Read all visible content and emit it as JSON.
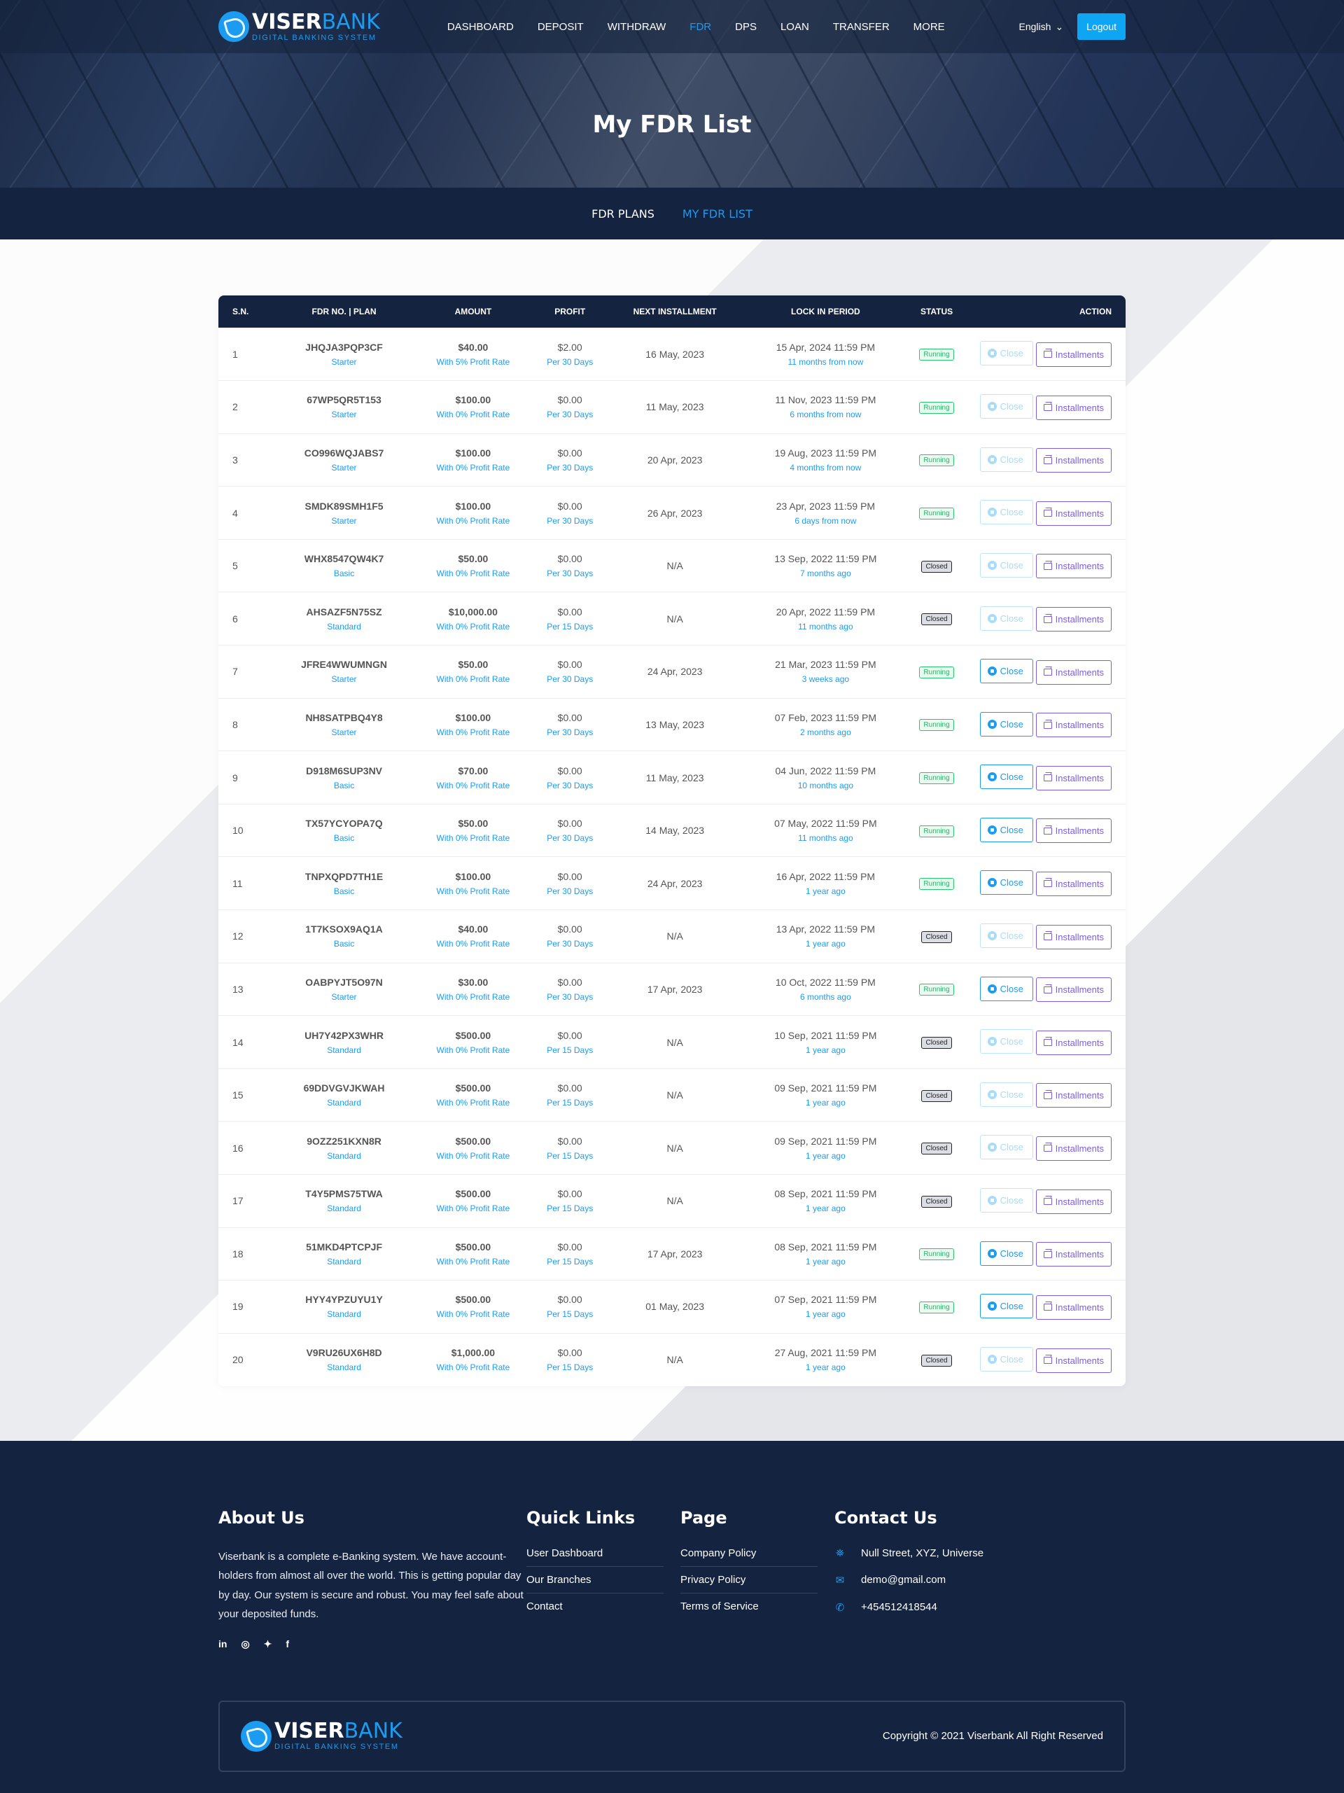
{
  "brand": {
    "name_main": "VISER",
    "name_accent": "BANK",
    "tagline": "DIGITAL BANKING SYSTEM"
  },
  "nav": {
    "items": [
      {
        "label": "DASHBOARD",
        "active": false
      },
      {
        "label": "DEPOSIT",
        "active": false
      },
      {
        "label": "WITHDRAW",
        "active": false
      },
      {
        "label": "FDR",
        "active": true
      },
      {
        "label": "DPS",
        "active": false
      },
      {
        "label": "LOAN",
        "active": false
      },
      {
        "label": "TRANSFER",
        "active": false
      },
      {
        "label": "MORE",
        "active": false
      }
    ],
    "language": "English",
    "logout_label": "Logout"
  },
  "hero": {
    "title": "My FDR List"
  },
  "subnav": [
    {
      "label": "FDR PLANS",
      "active": false
    },
    {
      "label": "MY FDR LIST",
      "active": true
    }
  ],
  "table": {
    "columns": [
      "S.N.",
      "FDR NO. | PLAN",
      "AMOUNT",
      "PROFIT",
      "NEXT INSTALLMENT",
      "LOCK IN PERIOD",
      "STATUS",
      "ACTION"
    ],
    "close_label": "Close",
    "installments_label": "Installments",
    "rows": [
      {
        "sn": "1",
        "fdr_no": "JHQJA3PQP3CF",
        "plan": "Starter",
        "amount": "$40.00",
        "rate": "With 5% Profit Rate",
        "profit": "$2.00",
        "per": "Per 30 Days",
        "next": "16 May, 2023",
        "lock": "15 Apr, 2024 11:59 PM",
        "lock_rel": "11 months from now",
        "status": "Running",
        "close_enabled": false
      },
      {
        "sn": "2",
        "fdr_no": "67WP5QR5T153",
        "plan": "Starter",
        "amount": "$100.00",
        "rate": "With 0% Profit Rate",
        "profit": "$0.00",
        "per": "Per 30 Days",
        "next": "11 May, 2023",
        "lock": "11 Nov, 2023 11:59 PM",
        "lock_rel": "6 months from now",
        "status": "Running",
        "close_enabled": false
      },
      {
        "sn": "3",
        "fdr_no": "CO996WQJABS7",
        "plan": "Starter",
        "amount": "$100.00",
        "rate": "With 0% Profit Rate",
        "profit": "$0.00",
        "per": "Per 30 Days",
        "next": "20 Apr, 2023",
        "lock": "19 Aug, 2023 11:59 PM",
        "lock_rel": "4 months from now",
        "status": "Running",
        "close_enabled": false
      },
      {
        "sn": "4",
        "fdr_no": "SMDK89SMH1F5",
        "plan": "Starter",
        "amount": "$100.00",
        "rate": "With 0% Profit Rate",
        "profit": "$0.00",
        "per": "Per 30 Days",
        "next": "26 Apr, 2023",
        "lock": "23 Apr, 2023 11:59 PM",
        "lock_rel": "6 days from now",
        "status": "Running",
        "close_enabled": false
      },
      {
        "sn": "5",
        "fdr_no": "WHX8547QW4K7",
        "plan": "Basic",
        "amount": "$50.00",
        "rate": "With 0% Profit Rate",
        "profit": "$0.00",
        "per": "Per 30 Days",
        "next": "N/A",
        "lock": "13 Sep, 2022 11:59 PM",
        "lock_rel": "7 months ago",
        "status": "Closed",
        "close_enabled": false
      },
      {
        "sn": "6",
        "fdr_no": "AHSAZF5N75SZ",
        "plan": "Standard",
        "amount": "$10,000.00",
        "rate": "With 0% Profit Rate",
        "profit": "$0.00",
        "per": "Per 15 Days",
        "next": "N/A",
        "lock": "20 Apr, 2022 11:59 PM",
        "lock_rel": "11 months ago",
        "status": "Closed",
        "close_enabled": false
      },
      {
        "sn": "7",
        "fdr_no": "JFRE4WWUMNGN",
        "plan": "Starter",
        "amount": "$50.00",
        "rate": "With 0% Profit Rate",
        "profit": "$0.00",
        "per": "Per 30 Days",
        "next": "24 Apr, 2023",
        "lock": "21 Mar, 2023 11:59 PM",
        "lock_rel": "3 weeks ago",
        "status": "Running",
        "close_enabled": true
      },
      {
        "sn": "8",
        "fdr_no": "NH8SATPBQ4Y8",
        "plan": "Starter",
        "amount": "$100.00",
        "rate": "With 0% Profit Rate",
        "profit": "$0.00",
        "per": "Per 30 Days",
        "next": "13 May, 2023",
        "lock": "07 Feb, 2023 11:59 PM",
        "lock_rel": "2 months ago",
        "status": "Running",
        "close_enabled": true
      },
      {
        "sn": "9",
        "fdr_no": "D918M6SUP3NV",
        "plan": "Basic",
        "amount": "$70.00",
        "rate": "With 0% Profit Rate",
        "profit": "$0.00",
        "per": "Per 30 Days",
        "next": "11 May, 2023",
        "lock": "04 Jun, 2022 11:59 PM",
        "lock_rel": "10 months ago",
        "status": "Running",
        "close_enabled": true
      },
      {
        "sn": "10",
        "fdr_no": "TX57YCYOPA7Q",
        "plan": "Basic",
        "amount": "$50.00",
        "rate": "With 0% Profit Rate",
        "profit": "$0.00",
        "per": "Per 30 Days",
        "next": "14 May, 2023",
        "lock": "07 May, 2022 11:59 PM",
        "lock_rel": "11 months ago",
        "status": "Running",
        "close_enabled": true
      },
      {
        "sn": "11",
        "fdr_no": "TNPXQPD7TH1E",
        "plan": "Basic",
        "amount": "$100.00",
        "rate": "With 0% Profit Rate",
        "profit": "$0.00",
        "per": "Per 30 Days",
        "next": "24 Apr, 2023",
        "lock": "16 Apr, 2022 11:59 PM",
        "lock_rel": "1 year ago",
        "status": "Running",
        "close_enabled": true
      },
      {
        "sn": "12",
        "fdr_no": "1T7KSOX9AQ1A",
        "plan": "Basic",
        "amount": "$40.00",
        "rate": "With 0% Profit Rate",
        "profit": "$0.00",
        "per": "Per 30 Days",
        "next": "N/A",
        "lock": "13 Apr, 2022 11:59 PM",
        "lock_rel": "1 year ago",
        "status": "Closed",
        "close_enabled": false
      },
      {
        "sn": "13",
        "fdr_no": "OABPYJT5O97N",
        "plan": "Starter",
        "amount": "$30.00",
        "rate": "With 0% Profit Rate",
        "profit": "$0.00",
        "per": "Per 30 Days",
        "next": "17 Apr, 2023",
        "lock": "10 Oct, 2022 11:59 PM",
        "lock_rel": "6 months ago",
        "status": "Running",
        "close_enabled": true
      },
      {
        "sn": "14",
        "fdr_no": "UH7Y42PX3WHR",
        "plan": "Standard",
        "amount": "$500.00",
        "rate": "With 0% Profit Rate",
        "profit": "$0.00",
        "per": "Per 15 Days",
        "next": "N/A",
        "lock": "10 Sep, 2021 11:59 PM",
        "lock_rel": "1 year ago",
        "status": "Closed",
        "close_enabled": false
      },
      {
        "sn": "15",
        "fdr_no": "69DDVGVJKWAH",
        "plan": "Standard",
        "amount": "$500.00",
        "rate": "With 0% Profit Rate",
        "profit": "$0.00",
        "per": "Per 15 Days",
        "next": "N/A",
        "lock": "09 Sep, 2021 11:59 PM",
        "lock_rel": "1 year ago",
        "status": "Closed",
        "close_enabled": false
      },
      {
        "sn": "16",
        "fdr_no": "9OZZ251KXN8R",
        "plan": "Standard",
        "amount": "$500.00",
        "rate": "With 0% Profit Rate",
        "profit": "$0.00",
        "per": "Per 15 Days",
        "next": "N/A",
        "lock": "09 Sep, 2021 11:59 PM",
        "lock_rel": "1 year ago",
        "status": "Closed",
        "close_enabled": false
      },
      {
        "sn": "17",
        "fdr_no": "T4Y5PMS75TWA",
        "plan": "Standard",
        "amount": "$500.00",
        "rate": "With 0% Profit Rate",
        "profit": "$0.00",
        "per": "Per 15 Days",
        "next": "N/A",
        "lock": "08 Sep, 2021 11:59 PM",
        "lock_rel": "1 year ago",
        "status": "Closed",
        "close_enabled": false
      },
      {
        "sn": "18",
        "fdr_no": "51MKD4PTCPJF",
        "plan": "Standard",
        "amount": "$500.00",
        "rate": "With 0% Profit Rate",
        "profit": "$0.00",
        "per": "Per 15 Days",
        "next": "17 Apr, 2023",
        "lock": "08 Sep, 2021 11:59 PM",
        "lock_rel": "1 year ago",
        "status": "Running",
        "close_enabled": true
      },
      {
        "sn": "19",
        "fdr_no": "HYY4YPZUYU1Y",
        "plan": "Standard",
        "amount": "$500.00",
        "rate": "With 0% Profit Rate",
        "profit": "$0.00",
        "per": "Per 15 Days",
        "next": "01 May, 2023",
        "lock": "07 Sep, 2021 11:59 PM",
        "lock_rel": "1 year ago",
        "status": "Running",
        "close_enabled": true
      },
      {
        "sn": "20",
        "fdr_no": "V9RU26UX6H8D",
        "plan": "Standard",
        "amount": "$1,000.00",
        "rate": "With 0% Profit Rate",
        "profit": "$0.00",
        "per": "Per 15 Days",
        "next": "N/A",
        "lock": "27 Aug, 2021 11:59 PM",
        "lock_rel": "1 year ago",
        "status": "Closed",
        "close_enabled": false
      }
    ]
  },
  "footer": {
    "about": {
      "title": "About Us",
      "text": "Viserbank is a complete e-Banking system. We have account-holders from almost all over the world. This is getting popular day by day. Our system is secure and robust. You may feel safe about your deposited funds.",
      "social": [
        {
          "name": "linkedin-icon",
          "glyph": "in"
        },
        {
          "name": "instagram-icon",
          "glyph": "◎"
        },
        {
          "name": "twitter-icon",
          "glyph": "🐦"
        },
        {
          "name": "facebook-icon",
          "glyph": "f"
        }
      ]
    },
    "quick_links": {
      "title": "Quick Links",
      "items": [
        "User Dashboard",
        "Our Branches",
        "Contact"
      ]
    },
    "page": {
      "title": "Page",
      "items": [
        "Company Policy",
        "Privacy Policy",
        "Terms of Service"
      ]
    },
    "contact": {
      "title": "Contact Us",
      "address": "Null Street, XYZ, Universe",
      "email": "demo@gmail.com",
      "phone": "+454512418544"
    },
    "copyright": "Copyright © 2021 Viserbank All Right Reserved"
  },
  "colors": {
    "primary": "#1b9cf0",
    "navy": "#14233f",
    "running": "#28c76f",
    "installments": "#7c5de6"
  }
}
